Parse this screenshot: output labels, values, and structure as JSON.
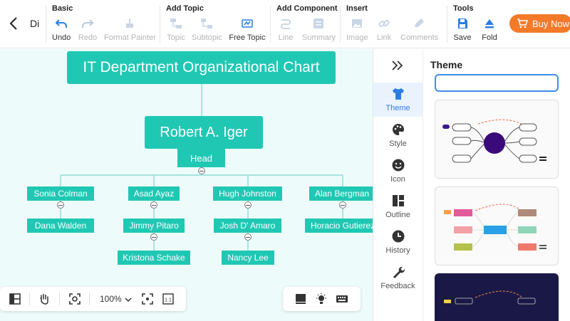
{
  "toolbar": {
    "doc_name": "Di",
    "groups": {
      "basic": "Basic",
      "add_topic": "Add Topic",
      "add_component": "Add Component",
      "insert": "Insert",
      "tools": "Tools"
    },
    "undo": "Undo",
    "redo": "Redo",
    "format_painter": "Format Painter",
    "topic": "Topic",
    "subtopic": "Subtopic",
    "free_topic": "Free Topic",
    "line": "Line",
    "summary": "Summary",
    "image": "Image",
    "link": "Link",
    "comments": "Comments",
    "save": "Save",
    "fold": "Fold",
    "buy_now": "Buy Now"
  },
  "chart": {
    "title": "IT Department Organizational Chart",
    "head_name": "Robert A. Iger",
    "head_role": "Head",
    "columns": [
      [
        "Sonia  Colman",
        "Dana Walden"
      ],
      [
        "Asad Ayaz",
        "Jimmy Pitaro",
        "Kristona Schake"
      ],
      [
        "Hugh Johnston",
        "Josh D' Amaro",
        "Nancy Lee"
      ],
      [
        "Alan Bergman",
        "Horacio Gutierez"
      ]
    ]
  },
  "bottom_bar": {
    "zoom": "100%"
  },
  "sidebar": {
    "items": [
      "Theme",
      "Style",
      "Icon",
      "Outline",
      "History",
      "Feedback"
    ],
    "panel_title": "Theme"
  },
  "colors": {
    "accent": "#20c8b4",
    "canvas": "#eefbfb",
    "buy_button": "#f47a2a",
    "active_blue": "#2b7de1"
  }
}
